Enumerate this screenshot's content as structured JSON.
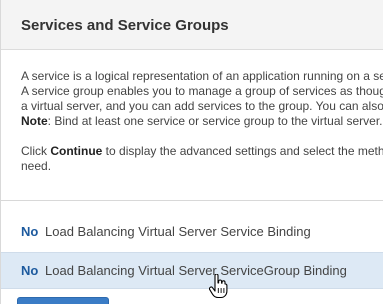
{
  "section": {
    "title": "Services and Service Groups"
  },
  "description": {
    "line1": "A service is a logical representation of an application running on a se",
    "line2": "A service group enables you to manage a group of services as thoug",
    "line3": "a virtual server, and you can add services to the group. You can also",
    "note_label": "Note",
    "note_text": ": Bind at least one service or service group to the virtual server.",
    "click_prefix": "Click ",
    "continue_word": "Continue",
    "click_suffix": " to display the advanced settings and select the metho",
    "line_need": "need."
  },
  "bindings": [
    {
      "count": "No",
      "label": "Load Balancing Virtual Server Service Binding"
    },
    {
      "count": "No",
      "label": "Load Balancing Virtual Server ServiceGroup Binding"
    }
  ],
  "colors": {
    "link_blue": "#1d5a9e",
    "highlight_row": "#dde9f5",
    "button_blue": "#3a7cc6"
  },
  "icons": {
    "cursor": "hand-pointer-icon"
  }
}
